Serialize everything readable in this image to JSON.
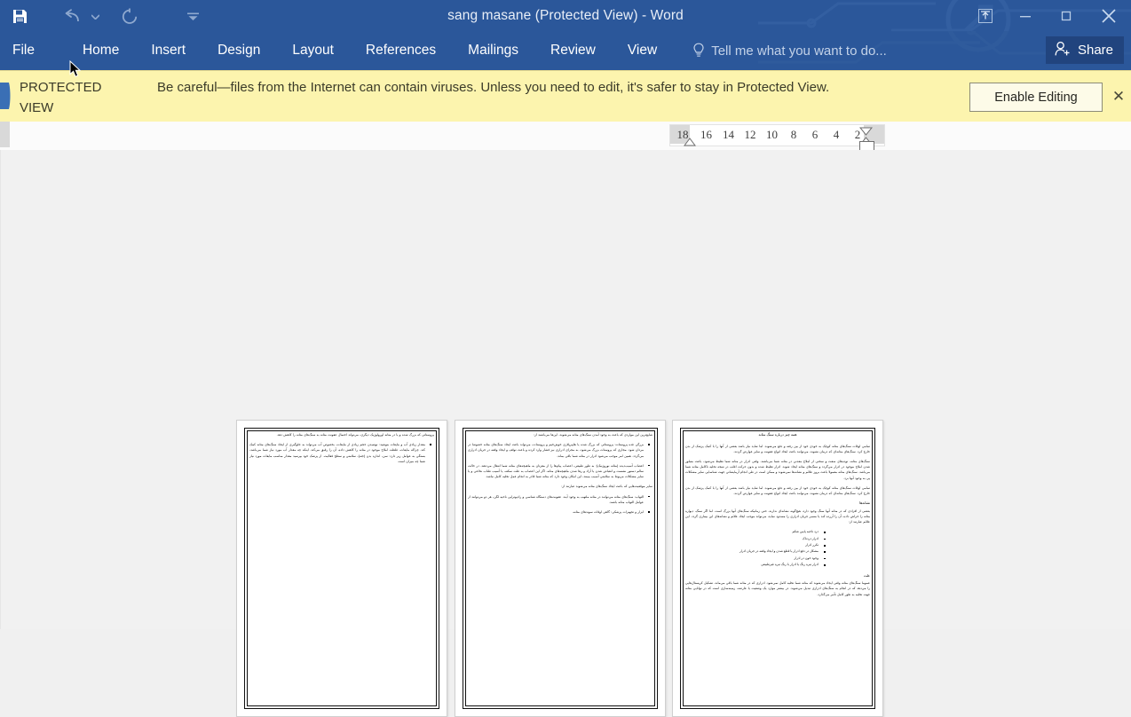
{
  "window": {
    "title": "sang masane (Protected View) - Word",
    "quick_access": [
      {
        "name": "save-icon",
        "label": "Save"
      },
      {
        "name": "undo-icon",
        "label": "Undo"
      },
      {
        "name": "undo-dropdown-icon",
        "label": "Undo options"
      },
      {
        "name": "redo-icon",
        "label": "Repeat"
      },
      {
        "name": "customize-qat-icon",
        "label": "Customize Quick Access Toolbar"
      }
    ],
    "controls": [
      {
        "name": "ribbon-display-options-icon",
        "label": "Ribbon Display Options"
      },
      {
        "name": "minimize-icon",
        "label": "Minimize"
      },
      {
        "name": "restore-icon",
        "label": "Restore Down"
      },
      {
        "name": "close-icon",
        "label": "Close"
      }
    ]
  },
  "ribbon": {
    "tabs": [
      {
        "label": "File"
      },
      {
        "label": "Home"
      },
      {
        "label": "Insert"
      },
      {
        "label": "Design"
      },
      {
        "label": "Layout"
      },
      {
        "label": "References"
      },
      {
        "label": "Mailings"
      },
      {
        "label": "Review"
      },
      {
        "label": "View"
      }
    ],
    "tell_me": "Tell me what you want to do...",
    "share_label": "Share"
  },
  "protected_view": {
    "label_line1": "PROTECTED",
    "label_line2": "VIEW",
    "message": "Be careful—files from the Internet can contain viruses. Unless you need to edit, it's safer to stay in Protected View.",
    "enable_button": "Enable Editing",
    "close_label": "✕"
  },
  "ruler": {
    "ticks": [
      "18",
      "16",
      "14",
      "12",
      "10",
      "8",
      "6",
      "4",
      "2"
    ],
    "markers": [
      "first-line-indent",
      "hanging-indent",
      "left-indent",
      "tab-stop"
    ]
  },
  "document": {
    "pages": [
      {
        "number": 1,
        "title": "",
        "blocks": [
          {
            "type": "para",
            "text": "پروستاتی که بزرگ شده و یا در مثانه اورولوژیک دیگری، می‌تواند احتمال عفونت مثانه به سنگ‌های مثانه را کاهش دهد."
          },
          {
            "type": "bullet",
            "text": "مقدار زیادی آب و مایعات بنوشید: نوشیدن حجم زیادی از مایعات، بخصوص آب می‌تواند به جلوگیری از ایجاد سنگ‌های مثانه کمک کند. چراکه مایعات، غلظت املاح موجود در مثانه را کاهش داده، آن را رقیق می‌کند. اینکه چه مقدار آب مورد نیاز شما می‌باشد، بستگی به عوامل زیر دارد: سن، اندازه بدن (جثه)، سلامتی و سطح فعالیت. از پزشک خود بپرسید مقدار مناسب مایعات مورد نیاز شما چه میزان است."
          }
        ]
      },
      {
        "number": 2,
        "title": "",
        "blocks": [
          {
            "type": "para",
            "text": "شایع‌ترین این مواردی که باعث به وجود آمدن سنگ‌های مثانه می‌شوند، این‌ها می‌باشند از:"
          },
          {
            "type": "bullet",
            "text": "بزرگی غده پروستات: پروستاتی که بزرگ شده یا هایپرپلازی خوش‌خیم و پروستات، می‌تواند باعث ایجاد سنگ‌های مثانه خصوصا در مردان شود. مجاری که پروستات بزرگ می‌شود، به مجرای ادراری نیز فشار وارد کرده و باعث توقف و ایجاد وقفه در جریان ادراری می‌گردد. همین امر موجب می‌شود ادرار در مثانه شما باقی بماند."
          },
          {
            "type": "bullet",
            "text": "اعصاب آسیب‌دیده (مثانه نوروژنیک): به طور طبیعی، اعصاب پیام‌ها را از مغزتان به ماهیچه‌های مثانه شما انتقال می‌دهند. در حالت سالم دستور نشست و انقباض شدن یا آزاد و رها شدن ماهیچه‌های مثانه. اگر این اعصاب به علت سکته، یا آسیب طناب نخاعی و یا سایر مشکلات مربوط به سلامتی آسیب ببینند، این امکان وجود دارد که مثانه شما قادر به انجام عمل تخلیه کامل نباشد."
          },
          {
            "type": "para",
            "text": "سایر موقعیت‌هایی که باعث ایجاد سنگ‌های مثانه می‌شوند عبارتند از:"
          },
          {
            "type": "bullet",
            "text": "التهاب: سنگ‌های مثانه می‌توانند در مثانه ملتهب به وجود آیند. عفونت‌های دستگاه شناسی و رادیوتراپی ناحیه لگن، هر دو می‌توانند از عوامل التهاب مثانه باشند."
          },
          {
            "type": "bullet",
            "text": "ابزار و تجهیزات پزشکی: گاهی اوقات سوندهای مثانه،"
          }
        ]
      },
      {
        "number": 3,
        "title": "همه چیز درباره سنگ مثانه",
        "blocks": [
          {
            "type": "para",
            "text": "تمامی اوقات سنگ‌های مثانه کوچک به خودی خود از بین رفته و دفع می‌شوند. اما شاید نیاز باشد بعضی از آنها را با کمک پزشک از بدن خارج کرد. سنگ‌های مثانه‌ای که درمان نشوند، می‌توانند باعث ایجاد انواع عفونت و سایر عوارض گردند."
          },
          {
            "type": "para",
            "text": "سنگ‌های مثانه، توده‌های سفت و سختی از املاح معدنی در مثانه شما می‌باشند. وقتی ادرار در مثانه شما تغلیظ می‌شود، باعث متبلور شدن املاح موجود در ادرار می‌گردد و سنگ‌های مثانه ایجاد شوند. ادرار تغلیظ شده و بدون حرکت اغلب در نتیجه تخلیه ناکامل مثانه شما می‌باشد. سنگ‌های مثانه معمولا باعث بروز علائم و نشانه‌ها نمی‌شوند و ممکن است در طی انجام آزمایشاتی جهت شناسایی سایر مشکلات پی به وجود آنها برد."
          },
          {
            "type": "para",
            "text": "تمامی اوقات سنگ‌های مثانه کوچک به خودی خود از بین رفته و دفع می‌شوند. اما شاید نیاز باشد بعضی از آنها را با کمک پزشک از بدن خارج کرد. سنگ‌های مثانه‌ای که درمان نشوند، می‌توانند باعث ایجاد انواع عفونت و سایر عوارض گردند."
          },
          {
            "type": "subhead",
            "text": "نشانه‌ها"
          },
          {
            "type": "para",
            "text": "بعضی از افرادی که در مثانه آنها سنگ وجود دارد، هیچ‌گونه نشانه‌ای ندارند، حتی زمانیکه سنگ‌های آنها بزرگ است. اما اگر سنگ، دیواره مثانه را خراش داده، آن را آزرده کند یا مسیر جریان ادراری را مسدود نماید، می‌تواند موجب ایجاد علائم و نشانه‌های این بیماری گردد. این علائم عبارتند از:",
            "list": [
              "درد ناحیه پایین شکم",
              "ادرار دردناک",
              "تکرر ادرار",
              "مشکل در دفع ادرار یا قطع شدن و ایجاد وقفه در جریان ادرار",
              "وجود خون در ادرار",
              "ادرار تیره رنگ یا ادرار با رنگ تیره غیرطبیعی"
            ]
          },
          {
            "type": "subhead",
            "text": "علت"
          },
          {
            "type": "para",
            "text": "عموما سنگ‌های مثانه وقتی ایجاد می‌شوند که مثانه شما تخلیه کامل نمی‌شود. ادراری که در مثانه شما باقی می‌ماند، تشکیل کریستال‌هایی را می‌دهد که در انجام به سنگ‌های ادراری تبدیل می‌شوند. در بیشتر موارد یک وضعیت یا عارضه، زمینه‌سازی است که در توانایی مثانه جهت تخلیه به طور کامل تأثیر می‌گذارد."
          }
        ]
      }
    ]
  }
}
